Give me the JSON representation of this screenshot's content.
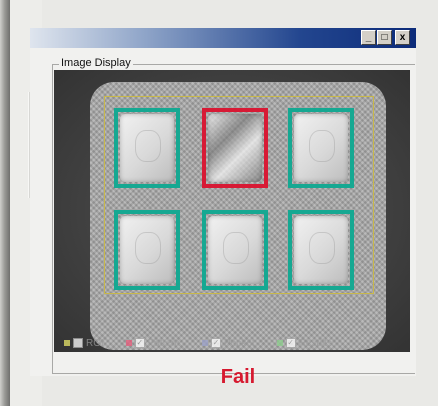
{
  "window": {
    "buttons": {
      "minimize": "_",
      "maximize": "□",
      "close": "x"
    }
  },
  "image_display": {
    "title": "Image Display",
    "legend": [
      {
        "label": "ROI",
        "checked": false,
        "color": "#e8e66a"
      },
      {
        "label": "Pattern",
        "checked": true,
        "color": "#e85a7a"
      },
      {
        "label": "Pocket",
        "checked": true,
        "color": "#9aa0c8"
      },
      {
        "label": "Results",
        "checked": true,
        "color": "#8ccf8c"
      }
    ]
  },
  "inspection": {
    "pockets": [
      {
        "row": 1,
        "col": 1,
        "status": "pass",
        "tablet_present": true
      },
      {
        "row": 1,
        "col": 2,
        "status": "fail",
        "tablet_present": false
      },
      {
        "row": 1,
        "col": 3,
        "status": "pass",
        "tablet_present": true
      },
      {
        "row": 2,
        "col": 1,
        "status": "pass",
        "tablet_present": true
      },
      {
        "row": 2,
        "col": 2,
        "status": "pass",
        "tablet_present": true
      },
      {
        "row": 2,
        "col": 3,
        "status": "pass",
        "tablet_present": true
      }
    ],
    "colors": {
      "pass": "#16a892",
      "fail": "#d71a35"
    }
  },
  "result": {
    "label": "Fail",
    "color": "#d6192f"
  }
}
